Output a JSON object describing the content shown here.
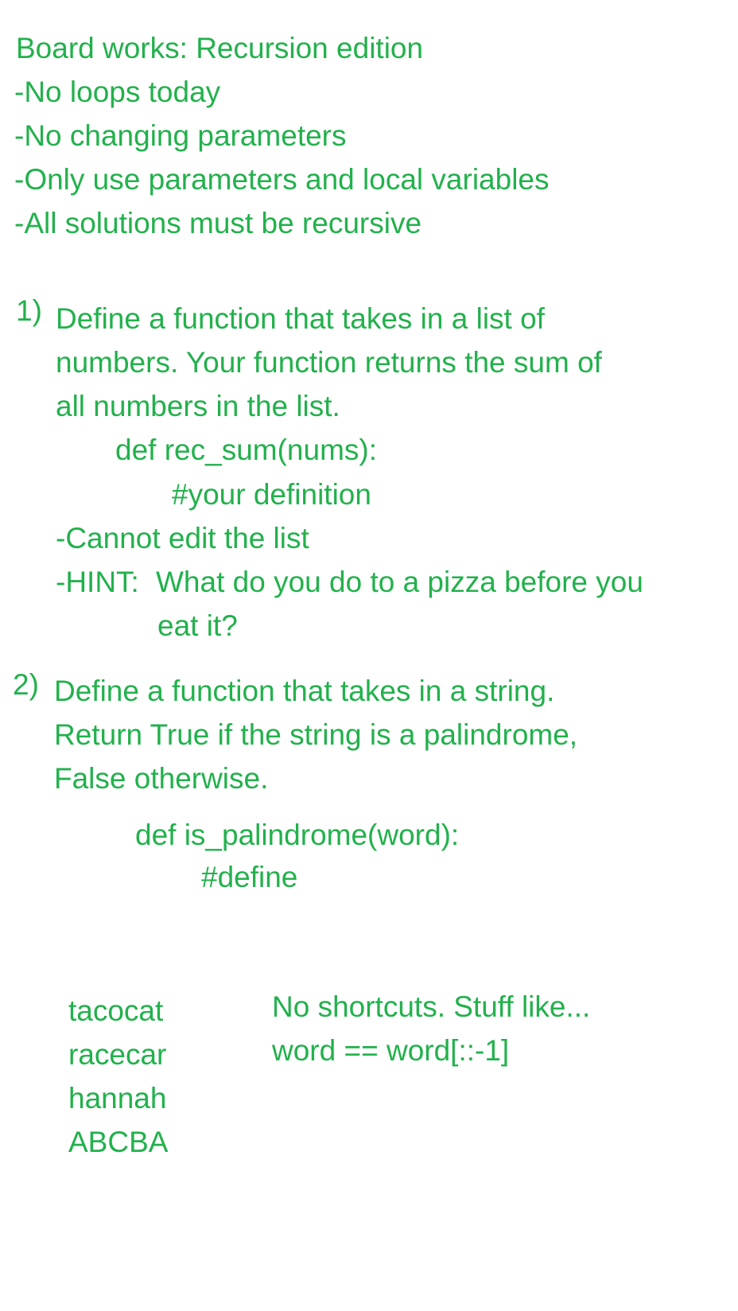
{
  "header": {
    "title": "Board works: Recursion edition",
    "rules": [
      "-No loops today",
      "-No changing parameters",
      "-Only use parameters and local variables",
      "-All solutions must be recursive"
    ]
  },
  "problem1": {
    "number": "1)",
    "lines": [
      "Define a function that takes in a list of",
      "numbers. Your function returns the sum of",
      "all numbers in the list."
    ],
    "code_signature": "def rec_sum(nums):",
    "code_body": "#your definition",
    "note": "-Cannot edit the list",
    "hint_label": "-HINT:",
    "hint_line1": "What do you do to a pizza before you",
    "hint_line2": "eat it?"
  },
  "problem2": {
    "number": "2)",
    "lines": [
      "Define a function that takes in a string.",
      "Return True if the string is a palindrome,",
      "False otherwise."
    ],
    "code_signature": "def is_palindrome(word):",
    "code_body": "#define",
    "examples": [
      "tacocat",
      "racecar",
      "hannah",
      "ABCBA"
    ],
    "shortcut_note": "No shortcuts. Stuff like...",
    "shortcut_code": "word == word[::-1]"
  },
  "colors": {
    "text": "#22b14c",
    "background": "#ffffff"
  }
}
